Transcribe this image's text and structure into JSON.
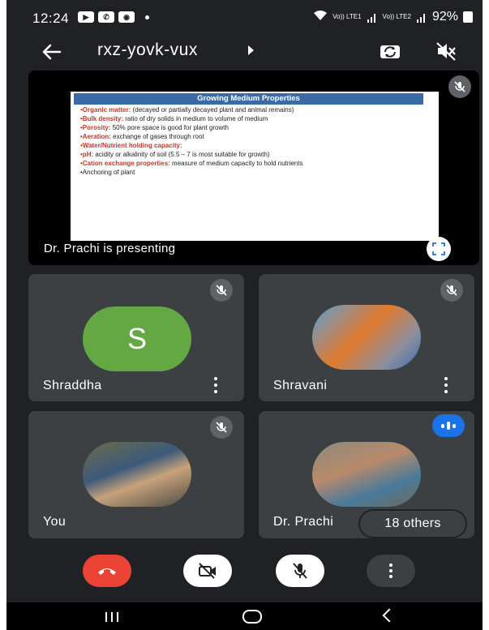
{
  "status_bar": {
    "time": "12:24",
    "icons": [
      "message-icon",
      "whatsapp-icon",
      "app-icon"
    ],
    "network_1": "Vo)) LTE1",
    "network_2": "Vo)) LTE2",
    "battery": "92%"
  },
  "header": {
    "meeting_code": "rxz-yovk-vux",
    "icons": [
      "back-arrow-icon",
      "camera-switch-icon",
      "volume-off-icon"
    ]
  },
  "presentation": {
    "caption": "Dr. Prachi is presenting",
    "slide": {
      "title": "Growing Medium Properties",
      "lines": [
        {
          "label": "•Organic matter:",
          "text": " (decayed or partially decayed plant and animal remains)"
        },
        {
          "label": "•Bulk density:",
          "text": " ratio of dry solids in medium to volume of medium"
        },
        {
          "label": "•Porosity:",
          "text": " 50% pore space is good for plant growth"
        },
        {
          "label": "•Aeration:",
          "text": " exchange of gases through root"
        },
        {
          "label": "•Water/Nutrient holding capacity:",
          "text": ""
        },
        {
          "label": "•pH:",
          "text": " acidity or alkalinity of soil (5.5 – 7 is most suitable for growth)"
        },
        {
          "label": "•Cation exchange properties:",
          "text": " measure of medium capacity to hold nutrients"
        },
        {
          "label": "",
          "text": "•Anchoring of plant"
        }
      ]
    }
  },
  "participants": [
    {
      "name": "Shraddha",
      "avatar_letter": "S",
      "avatar_color": "#64a844",
      "muted": true
    },
    {
      "name": "Shravani",
      "avatar": "cartoon-fox-rabbit-photo",
      "muted": true
    },
    {
      "name": "You",
      "avatar": "profile-photo-man",
      "muted": true
    },
    {
      "name": "Dr. Prachi",
      "avatar": "profile-photo-woman",
      "speaking": true
    }
  ],
  "others_label": "18 others",
  "controls": [
    "end-call-icon",
    "camera-off-icon",
    "mic-off-icon",
    "more-options-icon"
  ],
  "colors": {
    "background": "#202124",
    "tile": "#3c4043",
    "end_call": "#ea4335",
    "speaking": "#1a73e8",
    "slide_title_bar": "#3a6aa8",
    "slide_keyword": "#c0392b"
  }
}
